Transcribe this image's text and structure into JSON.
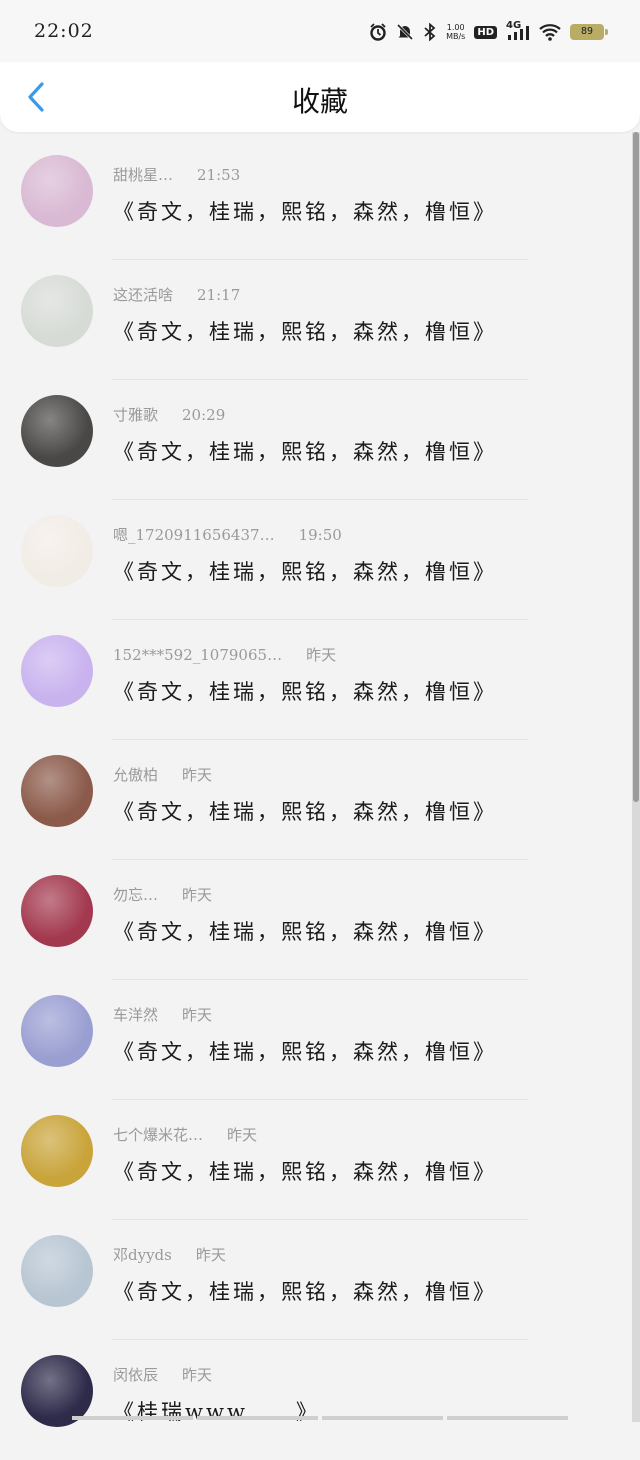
{
  "status_bar": {
    "time": "22:02",
    "net_speed_top": "1.00",
    "net_speed_bottom": "MB/s",
    "hd": "HD",
    "network": "4G",
    "battery": "89",
    "icons": [
      "alarm-icon",
      "mute-icon",
      "bluetooth-icon",
      "signal-icon",
      "wifi-icon",
      "battery-icon"
    ]
  },
  "header": {
    "title": "收藏",
    "back_icon": "chevron-left-icon",
    "accent": "#3a9ae8"
  },
  "favorites": [
    {
      "name": "甜桃星…",
      "time": "21:53",
      "message": "《奇文，桂瑞，熙铭，森然，橹恒》",
      "avatar_color": "#d9b9d3"
    },
    {
      "name": "这还活啥",
      "time": "21:17",
      "message": "《奇文，桂瑞，熙铭，森然，橹恒》",
      "avatar_color": "#d7dbd6"
    },
    {
      "name": "寸雅歌",
      "time": "20:29",
      "message": "《奇文，桂瑞，熙铭，森然，橹恒》",
      "avatar_color": "#4a4846"
    },
    {
      "name": "嗯_1720911656437…",
      "time": "19:50",
      "message": "《奇文，桂瑞，熙铭，森然，橹恒》",
      "avatar_color": "#f2ece6"
    },
    {
      "name": "152***592_1079065…",
      "time": "昨天",
      "message": "《奇文，桂瑞，熙铭，森然，橹恒》",
      "avatar_color": "#c9b3ef"
    },
    {
      "name": "允傲柏",
      "time": "昨天",
      "message": "《奇文，桂瑞，熙铭，森然，橹恒》",
      "avatar_color": "#8b5a4a"
    },
    {
      "name": "勿忘…",
      "time": "昨天",
      "message": "《奇文，桂瑞，熙铭，森然，橹恒》",
      "avatar_color": "#a3394f"
    },
    {
      "name": "车洋然",
      "time": "昨天",
      "message": "《奇文，桂瑞，熙铭，森然，橹恒》",
      "avatar_color": "#9a9fd2"
    },
    {
      "name": "七个爆米花…",
      "time": "昨天",
      "message": "《奇文，桂瑞，熙铭，森然，橹恒》",
      "avatar_color": "#c9a43a"
    },
    {
      "name": "邓dyyds",
      "time": "昨天",
      "message": "《奇文，桂瑞，熙铭，森然，橹恒》",
      "avatar_color": "#b8c6d3"
    },
    {
      "name": "闵依辰",
      "time": "昨天",
      "message": "《桂瑞www……》",
      "avatar_color": "#2d2a4a"
    }
  ]
}
